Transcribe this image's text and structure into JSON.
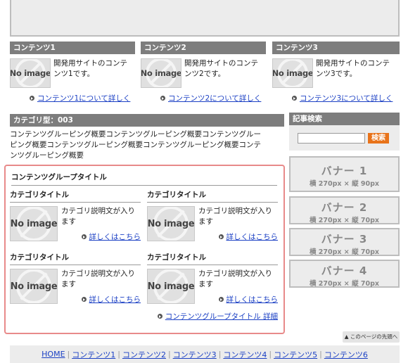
{
  "columns": [
    {
      "heading": "コンテンツ1",
      "image_label": "No image",
      "line1": "開発用サイトのコンテ",
      "line2": "ンツ1です。",
      "more": "コンテンツ1について詳しく"
    },
    {
      "heading": "コンテンツ2",
      "image_label": "No image",
      "line1": "開発用サイトのコンテ",
      "line2": "ンツ2です。",
      "more": "コンテンツ2について詳しく"
    },
    {
      "heading": "コンテンツ3",
      "image_label": "No image",
      "line1": "開発用サイトのコンテ",
      "line2": "ンツ3です。",
      "more": "コンテンツ3について詳しく"
    }
  ],
  "category": {
    "heading": "カテゴリ型：003",
    "desc_lines": [
      "コンテンツグルーピング概要コンテンツグルーピング概要コンテンツグルー",
      "ピング概要コンテンツグルーピング概要コンテンツグルーピング概要コンテ",
      "ンツグルーピング概要"
    ]
  },
  "group": {
    "title": "コンテンツグループタイトル",
    "more": "コンテンツグループタイトル 詳細",
    "cells": [
      {
        "title": "カテゴリタイトル",
        "image_label": "No image",
        "line1": "カテゴリ説明文が入り",
        "line2": "ます",
        "more": "詳しくはこちら"
      },
      {
        "title": "カテゴリタイトル",
        "image_label": "No image",
        "line1": "カテゴリ説明文が入り",
        "line2": "ます",
        "more": "詳しくはこちら"
      },
      {
        "title": "カテゴリタイトル",
        "image_label": "No image",
        "line1": "カテゴリ説明文が入り",
        "line2": "ます",
        "more": "詳しくはこちら"
      },
      {
        "title": "カテゴリタイトル",
        "image_label": "No image",
        "line1": "カテゴリ説明文が入り",
        "line2": "ます",
        "more": "詳しくはこちら"
      }
    ]
  },
  "sidebar": {
    "search_heading": "記事検索",
    "search_placeholder": "",
    "search_button": "検索",
    "banners": [
      {
        "title": "バナー 1",
        "size": "横 270px × 縦 90px"
      },
      {
        "title": "バナー 2",
        "size": "横 270px × 縦 70px"
      },
      {
        "title": "バナー 3",
        "size": "横 270px × 縦 70px"
      },
      {
        "title": "バナー 4",
        "size": "横 270px × 縦 70px"
      }
    ]
  },
  "pagetop": "▲ このページの先頭へ",
  "footer_links": [
    "HOME",
    "コンテンツ1",
    "コンテンツ2",
    "コンテンツ3",
    "コンテンツ4",
    "コンテンツ5",
    "コンテンツ6"
  ],
  "colors": {
    "header_gray": "#7d7d7d",
    "group_border": "#e88a8a",
    "link_blue": "#1a3fc4",
    "search_orange": "#e8731a"
  }
}
